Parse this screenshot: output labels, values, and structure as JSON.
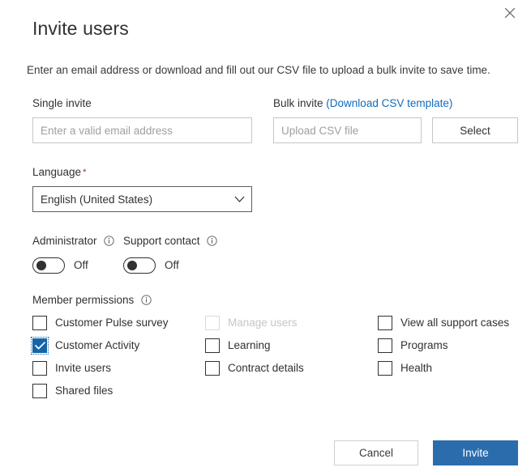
{
  "dialog": {
    "title": "Invite users",
    "description": "Enter an email address or download and fill out our CSV file to upload a bulk invite to save time.",
    "close_icon": "close-icon"
  },
  "single_invite": {
    "label": "Single invite",
    "placeholder": "Enter a valid email address",
    "value": ""
  },
  "bulk_invite": {
    "label": "Bulk invite",
    "link_text": "(Download CSV template)",
    "link_color": "#0f6cbd",
    "placeholder": "Upload CSV file",
    "value": "",
    "select_button": "Select"
  },
  "language": {
    "label": "Language",
    "required_marker": "*",
    "required_color": "#a4262c",
    "value": "English (United States)",
    "chevron_icon": "chevron-down-icon"
  },
  "toggles": [
    {
      "label": "Administrator",
      "state_text": "Off",
      "checked": false,
      "info_icon": "info-icon"
    },
    {
      "label": "Support contact",
      "state_text": "Off",
      "checked": false,
      "info_icon": "info-icon"
    }
  ],
  "member_permissions": {
    "title": "Member permissions",
    "info_icon": "info-icon",
    "columns": [
      [
        {
          "label": "Customer Pulse survey",
          "checked": false,
          "disabled": false
        },
        {
          "label": "Customer Activity",
          "checked": true,
          "disabled": false
        },
        {
          "label": "Invite users",
          "checked": false,
          "disabled": false
        },
        {
          "label": "Shared files",
          "checked": false,
          "disabled": false
        }
      ],
      [
        {
          "label": "Manage users",
          "checked": false,
          "disabled": true
        },
        {
          "label": "Learning",
          "checked": false,
          "disabled": false
        },
        {
          "label": "Contract details",
          "checked": false,
          "disabled": false
        }
      ],
      [
        {
          "label": "View all support cases",
          "checked": false,
          "disabled": false
        },
        {
          "label": "Programs",
          "checked": false,
          "disabled": false
        },
        {
          "label": "Health",
          "checked": false,
          "disabled": false
        }
      ]
    ],
    "checked_color": "#1566a8"
  },
  "footer": {
    "cancel_label": "Cancel",
    "invite_label": "Invite",
    "invite_color": "#2b6cad"
  }
}
